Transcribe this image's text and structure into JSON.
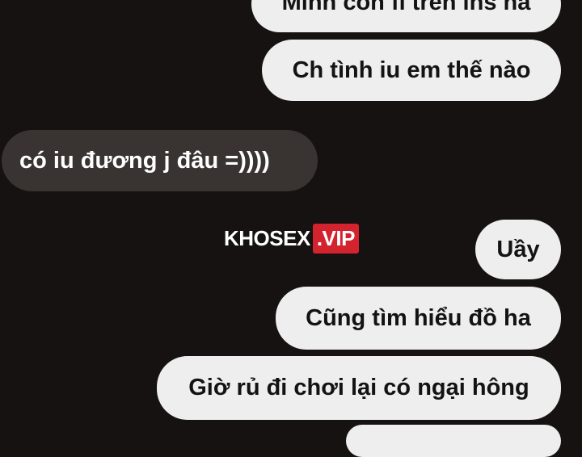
{
  "chat": {
    "messages": [
      {
        "direction": "outgoing",
        "text": "Mình còn fi trên ins hả"
      },
      {
        "direction": "outgoing",
        "text": "Ch tình iu em thế nào"
      },
      {
        "direction": "incoming",
        "text": "có iu đương j đâu =))))"
      },
      {
        "direction": "outgoing",
        "text": "Uầy"
      },
      {
        "direction": "outgoing",
        "text": "Cũng tìm hiểu đồ ha"
      },
      {
        "direction": "outgoing",
        "text": "Giờ rủ đi chơi lại có ngại hông"
      },
      {
        "direction": "outgoing",
        "text": ""
      }
    ]
  },
  "watermark": {
    "part1": "KHOSEX",
    "part2": ".VIP"
  },
  "colors": {
    "background": "#151211",
    "outgoing_bubble": "#eeeeee",
    "incoming_bubble": "#393431",
    "watermark_accent": "#d3232e"
  }
}
